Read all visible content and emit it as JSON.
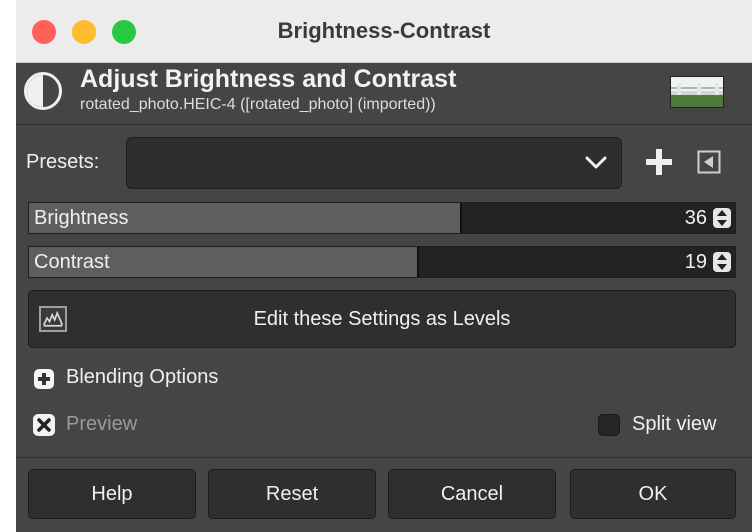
{
  "window": {
    "title": "Brightness-Contrast"
  },
  "header": {
    "title": "Adjust Brightness and Contrast",
    "subtitle": "rotated_photo.HEIC-4 ([rotated_photo] (imported))",
    "icon": "brightness-contrast-icon"
  },
  "presets": {
    "label": "Presets:",
    "value": "",
    "add_icon": "plus-icon",
    "menu_icon": "triangle-left-icon"
  },
  "brightness": {
    "label": "Brightness",
    "value": "36",
    "fill_fraction": 0.61
  },
  "contrast": {
    "label": "Contrast",
    "value": "19",
    "fill_fraction": 0.55
  },
  "levels_button": {
    "label": "Edit these Settings as Levels",
    "icon": "levels-icon"
  },
  "blending": {
    "label": "Blending Options",
    "expanded": false
  },
  "preview": {
    "label": "Preview",
    "checked": true
  },
  "split_view": {
    "label": "Split view",
    "checked": false
  },
  "buttons": {
    "help": "Help",
    "reset": "Reset",
    "cancel": "Cancel",
    "ok": "OK"
  }
}
